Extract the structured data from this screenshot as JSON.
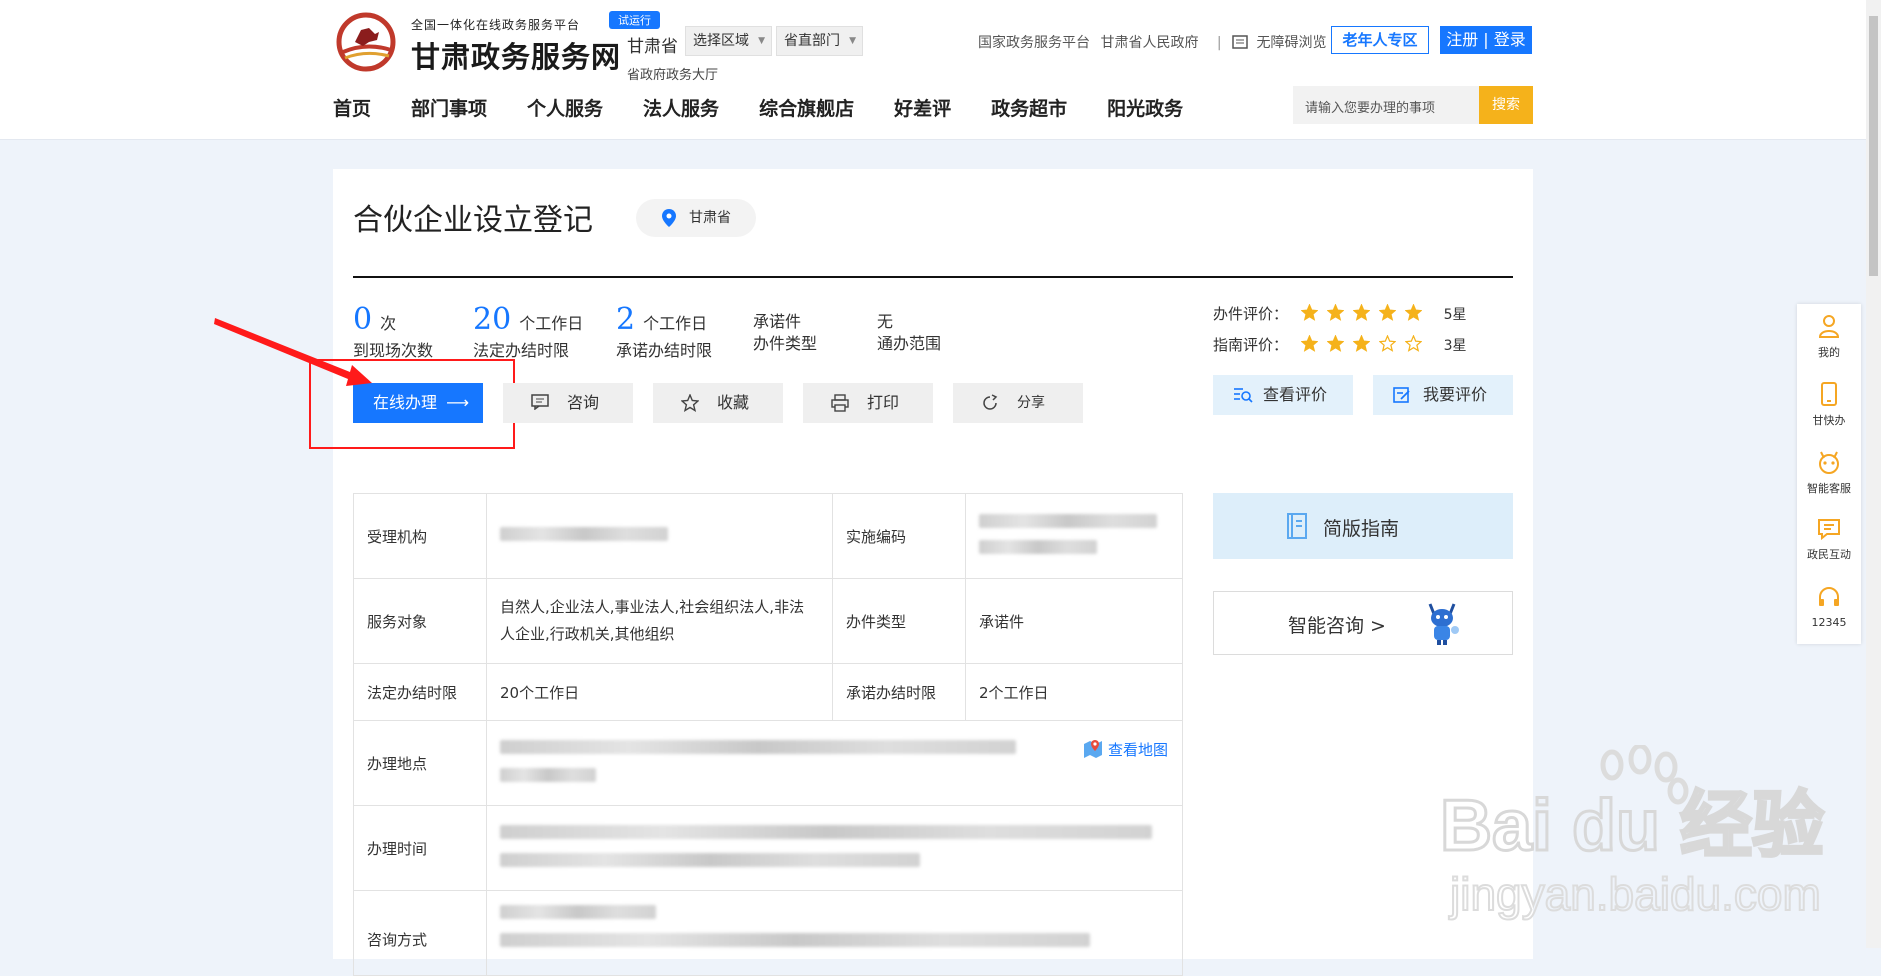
{
  "header": {
    "logo_sub": "全国一体化在线政务服务平台",
    "logo_main": "甘肃政务服务网",
    "trial_badge": "试运行",
    "region": "甘肃省",
    "region_select": "选择区域",
    "dept_select": "省直部门",
    "hall": "省政府政务大厅",
    "links": [
      "国家政务服务平台",
      "甘肃省人民政府"
    ],
    "accessible": "无障碍浏览",
    "elder_zone": "老年人专区",
    "register": "注册",
    "login": "登录"
  },
  "nav": [
    "首页",
    "部门事项",
    "个人服务",
    "法人服务",
    "综合旗舰店",
    "好差评",
    "政务超市",
    "阳光政务"
  ],
  "search": {
    "placeholder": "请输入您要办理的事项",
    "button": "搜索"
  },
  "item": {
    "title": "合伙企业设立登记",
    "location": "甘肃省",
    "stats": [
      {
        "num": "0",
        "unit": "次",
        "label": "到现场次数"
      },
      {
        "num": "20",
        "unit": "个工作日",
        "label": "法定办结时限"
      },
      {
        "num": "2",
        "unit": "个工作日",
        "label": "承诺办结时限"
      }
    ],
    "type_value": "承诺件",
    "type_label": "办件类型",
    "scope_value": "无",
    "scope_label": "通办范围"
  },
  "actions": {
    "online": "在线办理",
    "consult": "咨询",
    "favorite": "收藏",
    "print": "打印",
    "share": "分享"
  },
  "ratings": {
    "case_label": "办件评价：",
    "case_stars": 5,
    "case_value": "5星",
    "guide_label": "指南评价：",
    "guide_stars": 3,
    "guide_value": "3星",
    "view": "查看评价",
    "give": "我要评价"
  },
  "table": {
    "agency_label": "受理机构",
    "code_label": "实施编码",
    "target_label": "服务对象",
    "target_value": "自然人,企业法人,事业法人,社会组织法人,非法人企业,行政机关,其他组织",
    "type_label": "办件类型",
    "type_value": "承诺件",
    "legal_label": "法定办结时限",
    "legal_value": "20个工作日",
    "promise_label": "承诺办结时限",
    "promise_value": "2个工作日",
    "place_label": "办理地点",
    "map_link": "查看地图",
    "time_label": "办理时间",
    "contact_label": "咨询方式"
  },
  "side_panel": {
    "guide": "简版指南",
    "smart": "智能咨询 >"
  },
  "sidebar": [
    "我的",
    "甘快办",
    "智能客服",
    "政民互动",
    "12345"
  ],
  "watermark": {
    "brand": "Bai du 经验",
    "url": "jingyan.baidu.com"
  }
}
